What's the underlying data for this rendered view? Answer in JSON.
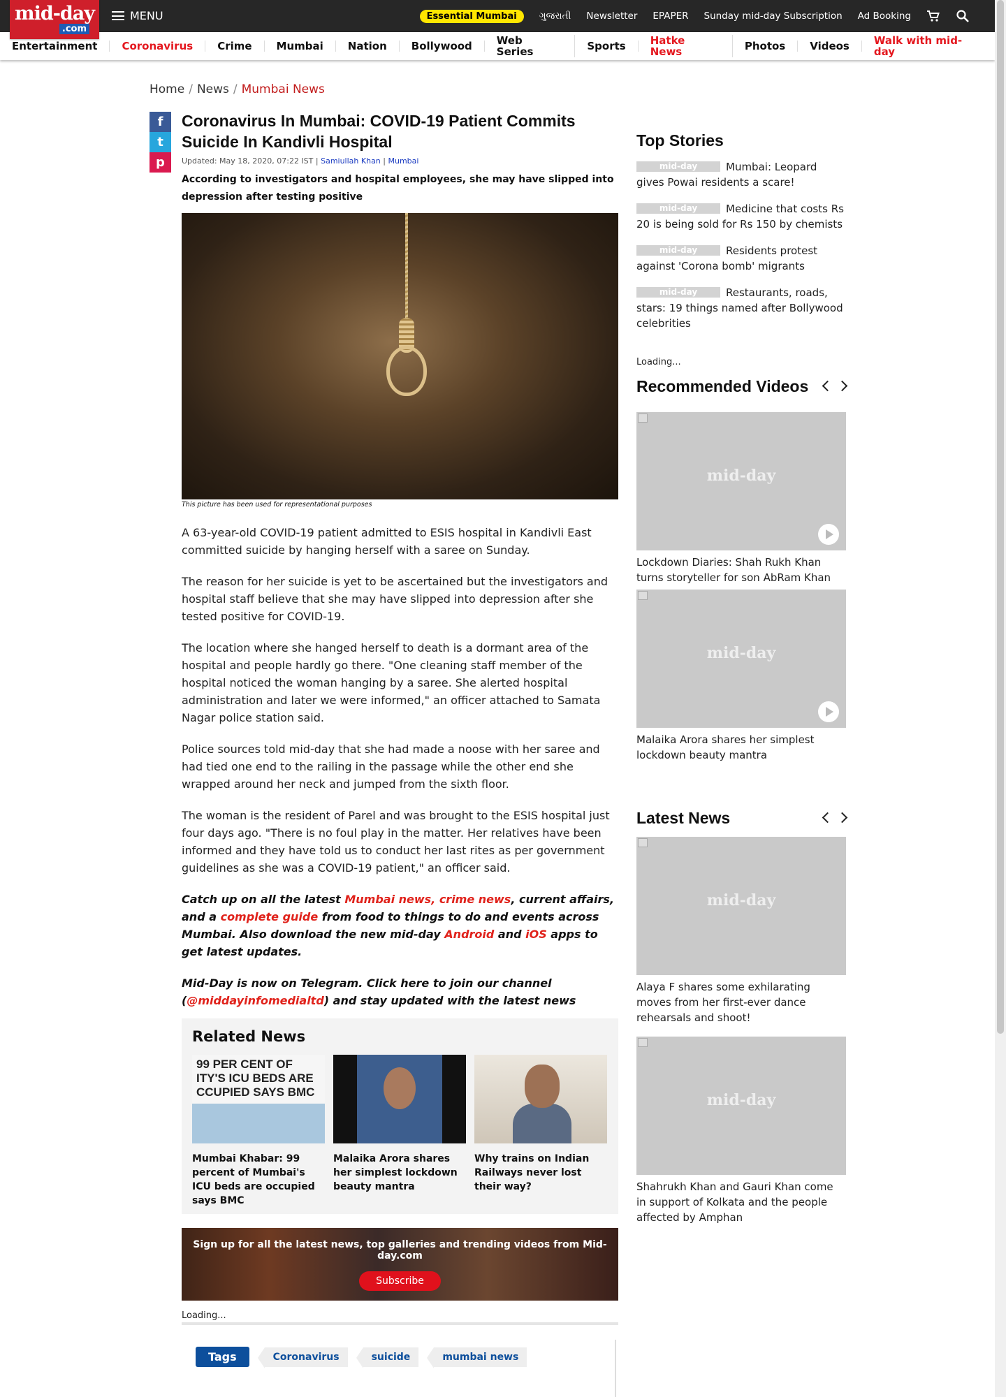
{
  "logo": {
    "main": "mid-day",
    "sub": ".com"
  },
  "menu": {
    "label": "MENU"
  },
  "top_links": {
    "essential": "Essential Mumbai",
    "gujarati": "ગુજરાતી",
    "newsletter": "Newsletter",
    "epaper": "EPAPER",
    "subscription": "Sunday mid-day Subscription",
    "ad_booking": "Ad Booking"
  },
  "nav": [
    {
      "label": "Entertainment",
      "highlight": false
    },
    {
      "label": "Coronavirus",
      "highlight": true
    },
    {
      "label": "Crime",
      "highlight": false
    },
    {
      "label": "Mumbai",
      "highlight": false
    },
    {
      "label": "Nation",
      "highlight": false
    },
    {
      "label": "Bollywood",
      "highlight": false
    },
    {
      "label": "Web Series",
      "highlight": false
    },
    {
      "label": "Sports",
      "highlight": false
    },
    {
      "label": "Hatke News",
      "highlight": true
    },
    {
      "label": "Photos",
      "highlight": false
    },
    {
      "label": "Videos",
      "highlight": false
    },
    {
      "label": "Walk with mid-day",
      "highlight": true
    }
  ],
  "breadcrumb": {
    "home": "Home",
    "news": "News",
    "current": "Mumbai News",
    "sep": "/"
  },
  "share": {
    "facebook": "f",
    "twitter": "t",
    "pinterest": "p"
  },
  "article": {
    "title": "Coronavirus In Mumbai: COVID-19 Patient Commits Suicide In Kandivli Hospital",
    "updated": "Updated: May 18, 2020, 07:22 IST",
    "author": "Samiullah Khan",
    "location": "Mumbai",
    "summary": "According to investigators and hospital employees, she may have slipped into depression after testing positive",
    "caption": "This picture has been used for representational purposes",
    "paragraphs": [
      "A 63-year-old COVID-19 patient admitted to ESIS hospital in Kandivli East committed suicide by hanging herself with a saree on Sunday.",
      "The reason for her suicide is yet to be ascertained but the investigators and hospital staff believe that she may have slipped into depression after she tested positive for COVID-19.",
      "The location where she hanged herself to death is a dormant area of the hospital and people hardly go there. \"One cleaning staff member of the hospital noticed the woman hanging by a saree. She alerted hospital administration and later we were informed,\" an officer attached to Samata Nagar police station said.",
      "Police sources told mid-day that she had made a noose with her saree and had tied one end to the railing in the passage while the other end she wrapped around her neck and jumped from the sixth floor.",
      "The woman is the resident of Parel and was brought to the ESIS hospital just four days ago. \"There is no foul play in the matter. Her relatives have been informed and they have told us to conduct her last rites as per government guidelines as she was a COVID-19 patient,\" an officer said."
    ],
    "promo1": {
      "t1": "Catch up on all the latest ",
      "l1": "Mumbai news, crime news",
      "t2": ", current affairs, and a ",
      "l2": "complete guide",
      "t3": " from food to things to do and events across Mumbai. Also download the new mid-day ",
      "l3": "Android",
      "t4": " and ",
      "l4": "iOS",
      "t5": " apps to get latest updates."
    },
    "promo2": {
      "t1": "Mid-Day is now on Telegram. Click here to join our channel (",
      "l1": "@middayinfomedialtd",
      "t2": ") and stay updated with the latest news"
    }
  },
  "related": {
    "heading": "Related News",
    "items": [
      {
        "title": "Mumbai Khabar: 99 percent of Mumbai's ICU beds are occupied says BMC",
        "image_text": "99 PER CENT OF ITY'S ICU BEDS ARE CCUPIED SAYS BMC"
      },
      {
        "title": "Malaika Arora shares her simplest lockdown beauty mantra"
      },
      {
        "title": "Why trains on Indian Railways never lost their way?"
      }
    ]
  },
  "subscribe": {
    "text": "Sign up for all the latest news, top galleries and trending videos from Mid-day.com",
    "button": "Subscribe"
  },
  "loading_text": "Loading...",
  "tags": {
    "label": "Tags",
    "items": [
      "Coronavirus",
      "suicide",
      "mumbai news"
    ]
  },
  "sidebar": {
    "top_stories_heading": "Top Stories",
    "placeholder_logo": "mid-day",
    "top_stories": [
      "Mumbai: Leopard gives Powai residents a scare!",
      "Medicine that costs Rs 20 is being sold for Rs 150 by chemists",
      "Residents protest against 'Corona bomb' migrants",
      "Restaurants, roads, stars: 19 things named after Bollywood celebrities"
    ],
    "loading": "Loading...",
    "recommended_heading": "Recommended Videos",
    "recommended": [
      "Lockdown Diaries: Shah Rukh Khan turns storyteller for son AbRam Khan",
      "Malaika Arora shares her simplest lockdown beauty mantra"
    ],
    "latest_heading": "Latest News",
    "latest": [
      "Alaya F shares some exhilarating moves from her first-ever dance rehearsals and shoot!",
      "Shahrukh Khan and Gauri Khan come in support of Kolkata and the people affected by Amphan"
    ]
  }
}
